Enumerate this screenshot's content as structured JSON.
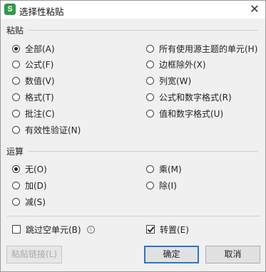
{
  "window": {
    "app_icon": "S",
    "title": "选择性粘贴",
    "close_icon": "✕"
  },
  "paste": {
    "label": "粘贴",
    "options_left": [
      {
        "label": "全部(A)",
        "selected": true
      },
      {
        "label": "公式(F)",
        "selected": false
      },
      {
        "label": "数值(V)",
        "selected": false
      },
      {
        "label": "格式(T)",
        "selected": false
      },
      {
        "label": "批注(C)",
        "selected": false
      },
      {
        "label": "有效性验证(N)",
        "selected": false
      }
    ],
    "options_right": [
      {
        "label": "所有使用源主题的单元(H)",
        "selected": false
      },
      {
        "label": "边框除外(X)",
        "selected": false
      },
      {
        "label": "列宽(W)",
        "selected": false
      },
      {
        "label": "公式和数字格式(R)",
        "selected": false
      },
      {
        "label": "值和数字格式(U)",
        "selected": false
      }
    ]
  },
  "operation": {
    "label": "运算",
    "options_left": [
      {
        "label": "无(O)",
        "selected": true
      },
      {
        "label": "加(D)",
        "selected": false
      },
      {
        "label": "减(S)",
        "selected": false
      }
    ],
    "options_right": [
      {
        "label": "乘(M)",
        "selected": false
      },
      {
        "label": "除(I)",
        "selected": false
      }
    ]
  },
  "skip_blanks": {
    "label": "跳过空单元(B)",
    "checked": false,
    "info_icon": "i"
  },
  "transpose": {
    "label": "转置(E)",
    "checked": true
  },
  "buttons": {
    "paste_link": "粘贴链接(L)",
    "ok": "确定",
    "cancel": "取消"
  }
}
